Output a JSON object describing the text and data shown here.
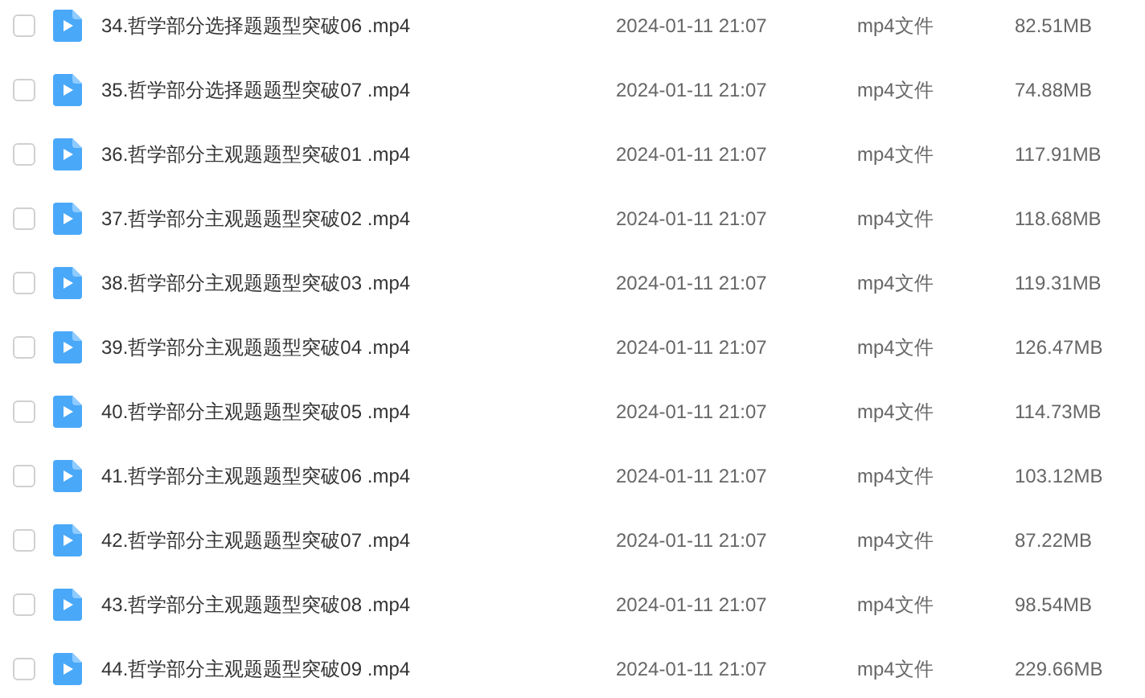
{
  "files": [
    {
      "name": "34.哲学部分选择题题型突破06 .mp4",
      "date": "2024-01-11 21:07",
      "type": "mp4文件",
      "size": "82.51MB",
      "checked": false
    },
    {
      "name": "35.哲学部分选择题题型突破07 .mp4",
      "date": "2024-01-11 21:07",
      "type": "mp4文件",
      "size": "74.88MB",
      "checked": false
    },
    {
      "name": "36.哲学部分主观题题型突破01 .mp4",
      "date": "2024-01-11 21:07",
      "type": "mp4文件",
      "size": "117.91MB",
      "checked": false
    },
    {
      "name": "37.哲学部分主观题题型突破02 .mp4",
      "date": "2024-01-11 21:07",
      "type": "mp4文件",
      "size": "118.68MB",
      "checked": false
    },
    {
      "name": "38.哲学部分主观题题型突破03 .mp4",
      "date": "2024-01-11 21:07",
      "type": "mp4文件",
      "size": "119.31MB",
      "checked": false
    },
    {
      "name": "39.哲学部分主观题题型突破04 .mp4",
      "date": "2024-01-11 21:07",
      "type": "mp4文件",
      "size": "126.47MB",
      "checked": false
    },
    {
      "name": "40.哲学部分主观题题型突破05 .mp4",
      "date": "2024-01-11 21:07",
      "type": "mp4文件",
      "size": "114.73MB",
      "checked": false
    },
    {
      "name": "41.哲学部分主观题题型突破06 .mp4",
      "date": "2024-01-11 21:07",
      "type": "mp4文件",
      "size": "103.12MB",
      "checked": false
    },
    {
      "name": "42.哲学部分主观题题型突破07 .mp4",
      "date": "2024-01-11 21:07",
      "type": "mp4文件",
      "size": "87.22MB",
      "checked": false
    },
    {
      "name": "43.哲学部分主观题题型突破08 .mp4",
      "date": "2024-01-11 21:07",
      "type": "mp4文件",
      "size": "98.54MB",
      "checked": false
    },
    {
      "name": "44.哲学部分主观题题型突破09 .mp4",
      "date": "2024-01-11 21:07",
      "type": "mp4文件",
      "size": "229.66MB",
      "checked": false
    }
  ]
}
